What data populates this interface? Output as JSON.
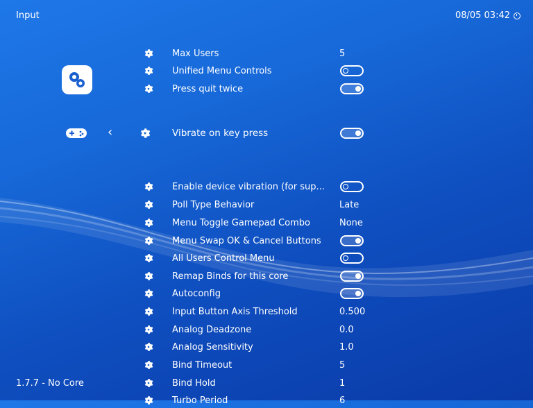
{
  "header": {
    "title": "Input",
    "datetime": "08/05 03:42"
  },
  "footer": {
    "version": "1.7.7 - No Core"
  },
  "colors": {
    "bg_top": "#1f78e8",
    "bg_bottom": "#0a3aa8"
  },
  "sidebar": {
    "settings_icon": "settings-gear-icon",
    "input_icon": "gamepad-icon",
    "back_icon": "chevron-left-icon"
  },
  "menu": {
    "items": [
      {
        "label": "Max Users",
        "value": "5"
      },
      {
        "label": "Unified Menu Controls",
        "toggle": "off"
      },
      {
        "label": "Press quit twice",
        "toggle": "on"
      },
      {
        "label": "Vibrate on key press",
        "toggle": "on",
        "selected": true
      },
      {
        "label": "Enable device vibration (for sup...",
        "toggle": "off"
      },
      {
        "label": "Poll Type Behavior",
        "value": "Late"
      },
      {
        "label": "Menu Toggle Gamepad Combo",
        "value": "None"
      },
      {
        "label": "Menu Swap OK & Cancel Buttons",
        "toggle": "on"
      },
      {
        "label": "All Users Control Menu",
        "toggle": "off"
      },
      {
        "label": "Remap Binds for this core",
        "toggle": "on"
      },
      {
        "label": "Autoconfig",
        "toggle": "on"
      },
      {
        "label": "Input Button Axis Threshold",
        "value": "0.500"
      },
      {
        "label": "Analog Deadzone",
        "value": "0.0"
      },
      {
        "label": "Analog Sensitivity",
        "value": "1.0"
      },
      {
        "label": "Bind Timeout",
        "value": "5"
      },
      {
        "label": "Bind Hold",
        "value": "1"
      },
      {
        "label": "Turbo Period",
        "value": "6"
      }
    ]
  }
}
